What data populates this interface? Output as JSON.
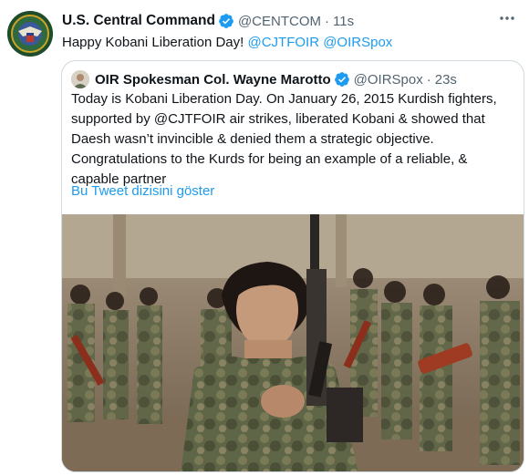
{
  "tweet": {
    "display_name": "U.S. Central Command",
    "handle": "@CENTCOM",
    "separator": "·",
    "time": "11s",
    "more_icon": "more-horizontal-icon",
    "text_prefix": "Happy Kobani Liberation Day! ",
    "mention_1": "@CJTFOIR",
    "text_space": " ",
    "mention_2": "@OIRSpox"
  },
  "quote": {
    "display_name": "OIR Spokesman Col. Wayne Marotto",
    "handle": "@OIRSpox",
    "separator": "·",
    "time": "23s",
    "lines": [
      "Today is Kobani Liberation Day. On January 26, 2015 Kurdish fighters,",
      "supported by @CJTFOIR air strikes, liberated  Kobani & showed that",
      "Daesh wasn’t invincible & denied them a strategic objective.",
      "Congratulations to the Kurds for being an example of a reliable, &",
      "capable partner"
    ],
    "translate_link": "Bu Tweet dizisini göster"
  },
  "colors": {
    "link": "#1d9bf0",
    "secondary_text": "#536471",
    "border": "#cfd9de",
    "verified": "#1d9bf0"
  }
}
